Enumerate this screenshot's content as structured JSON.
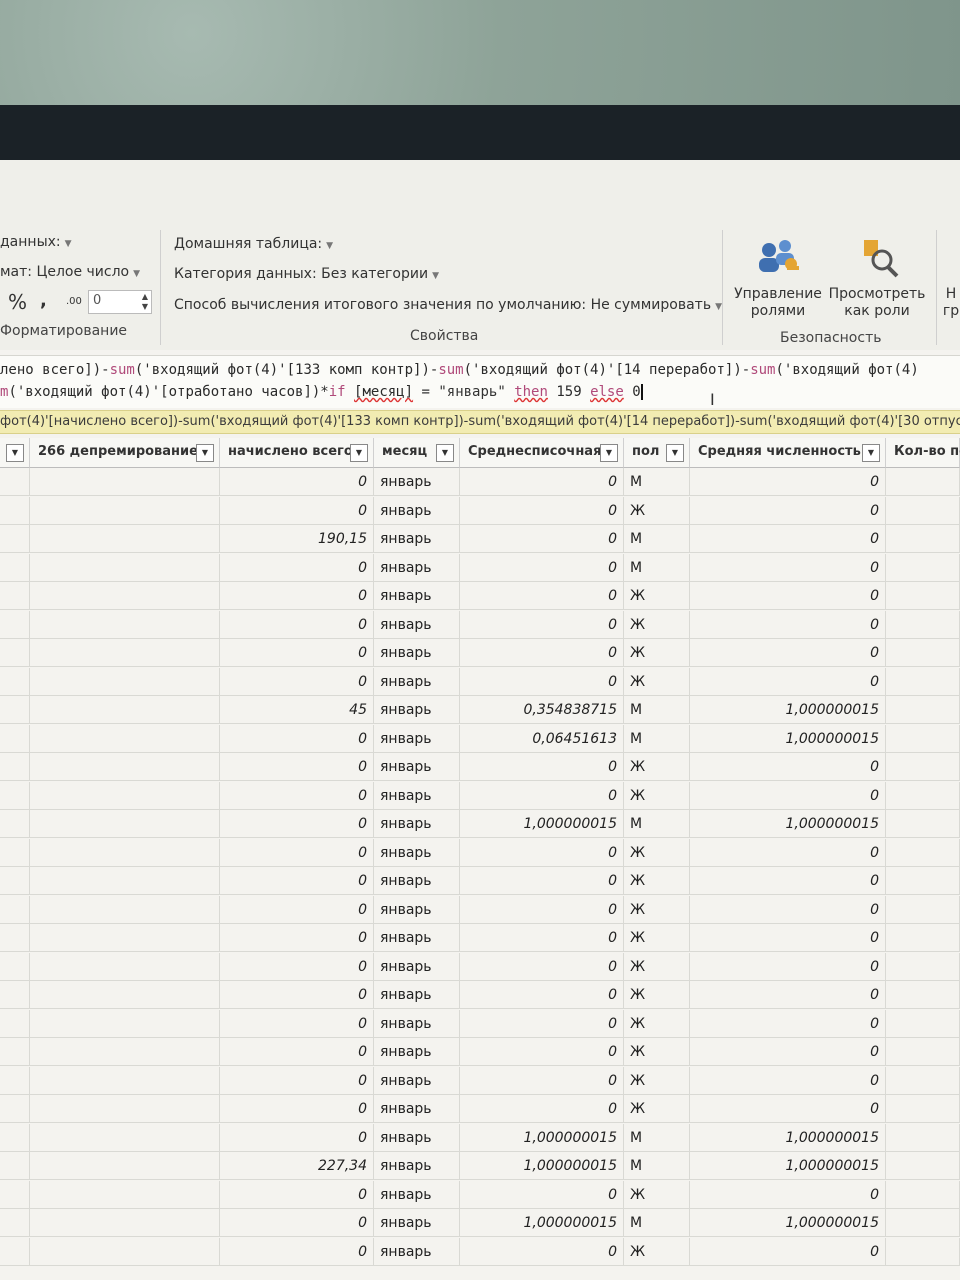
{
  "ribbon": {
    "data_type_label": "данных:",
    "format_label": "мат: Целое число",
    "percent_symbol": "%",
    "comma_symbol": ",",
    "decimal_symbol": ".00",
    "decimal_value": "0",
    "format_group": "Форматирование",
    "home_table": "Домашняя таблица:",
    "data_category": "Категория данных: Без категории",
    "summarize": "Способ вычисления итогового значения по умолчанию: Не суммировать",
    "properties_group": "Свойства",
    "manage_roles": [
      "Управление",
      "ролями"
    ],
    "view_as_roles": [
      "Просмотреть",
      "как роли"
    ],
    "security_group": "Безопасность",
    "cut_button": [
      "Н",
      "гр"
    ]
  },
  "formula": {
    "line1_a": "лено всего])-",
    "line1_b": "sum",
    "line1_c": "('входящий фот(4)'[133 комп контр])-",
    "line1_d": "sum",
    "line1_e": "('входящий фот(4)'[14 переработ])-",
    "line1_f": "sum",
    "line1_g": "('входящий фот(4)",
    "line2_a": "m",
    "line2_b": "('входящий фот(4)'[отработано часов])*",
    "line2_c": "if",
    "line2_d": "[месяц]",
    "line2_e": " = \"январь\" ",
    "line2_f": "then",
    "line2_g": " 159 ",
    "line2_h": "else",
    "line2_i": " 0"
  },
  "tooltip": "фот(4)'[начислено всего])-sum('входящий фот(4)'[133 комп контр])-sum('входящий фот(4)'[14 переработ])-sum('входящий фот(4)'[30 отпуск.])-su",
  "columns": [
    "266 депремирование",
    "начислено всего",
    "месяц",
    "Среднесписочная",
    "пол",
    "Средняя численность",
    "Кол-во по"
  ],
  "rows": [
    [
      "",
      "0",
      "январь",
      "0",
      "М",
      "0"
    ],
    [
      "",
      "0",
      "январь",
      "0",
      "Ж",
      "0"
    ],
    [
      "",
      "190,15",
      "январь",
      "0",
      "М",
      "0"
    ],
    [
      "",
      "0",
      "январь",
      "0",
      "М",
      "0"
    ],
    [
      "",
      "0",
      "январь",
      "0",
      "Ж",
      "0"
    ],
    [
      "",
      "0",
      "январь",
      "0",
      "Ж",
      "0"
    ],
    [
      "",
      "0",
      "январь",
      "0",
      "Ж",
      "0"
    ],
    [
      "",
      "0",
      "январь",
      "0",
      "Ж",
      "0"
    ],
    [
      "",
      "45",
      "январь",
      "0,354838715",
      "М",
      "1,000000015"
    ],
    [
      "",
      "0",
      "январь",
      "0,06451613",
      "М",
      "1,000000015"
    ],
    [
      "",
      "0",
      "январь",
      "0",
      "Ж",
      "0"
    ],
    [
      "",
      "0",
      "январь",
      "0",
      "Ж",
      "0"
    ],
    [
      "",
      "0",
      "январь",
      "1,000000015",
      "М",
      "1,000000015"
    ],
    [
      "",
      "0",
      "январь",
      "0",
      "Ж",
      "0"
    ],
    [
      "",
      "0",
      "январь",
      "0",
      "Ж",
      "0"
    ],
    [
      "",
      "0",
      "январь",
      "0",
      "Ж",
      "0"
    ],
    [
      "",
      "0",
      "январь",
      "0",
      "Ж",
      "0"
    ],
    [
      "",
      "0",
      "январь",
      "0",
      "Ж",
      "0"
    ],
    [
      "",
      "0",
      "январь",
      "0",
      "Ж",
      "0"
    ],
    [
      "",
      "0",
      "январь",
      "0",
      "Ж",
      "0"
    ],
    [
      "",
      "0",
      "январь",
      "0",
      "Ж",
      "0"
    ],
    [
      "",
      "0",
      "январь",
      "0",
      "Ж",
      "0"
    ],
    [
      "",
      "0",
      "январь",
      "0",
      "Ж",
      "0"
    ],
    [
      "",
      "0",
      "январь",
      "1,000000015",
      "М",
      "1,000000015"
    ],
    [
      "",
      "227,34",
      "январь",
      "1,000000015",
      "М",
      "1,000000015"
    ],
    [
      "",
      "0",
      "январь",
      "0",
      "Ж",
      "0"
    ],
    [
      "",
      "0",
      "январь",
      "1,000000015",
      "М",
      "1,000000015"
    ],
    [
      "",
      "0",
      "январь",
      "0",
      "Ж",
      "0"
    ]
  ]
}
